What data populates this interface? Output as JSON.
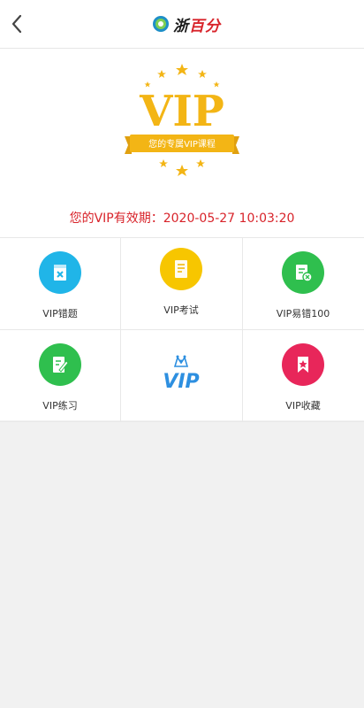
{
  "header": {
    "back_icon": "back-chevron-icon",
    "logo_text_a": "浙",
    "logo_text_b": "百分"
  },
  "badge": {
    "big_text": "VIP",
    "ribbon_text": "您的专属VIP课程"
  },
  "expiry_text": "您的VIP有效期：2020-05-27 10:03:20",
  "menu": [
    {
      "label": "VIP错题",
      "icon": "wrong-question-icon",
      "color": "#20b5e8"
    },
    {
      "label": "VIP考试",
      "icon": "exam-paper-icon",
      "color": "#f7c600"
    },
    {
      "label": "VIP易错100",
      "icon": "error-prone-icon",
      "color": "#2fbf4e"
    },
    {
      "label": "VIP练习",
      "icon": "practice-edit-icon",
      "color": "#2fbf4e"
    },
    {
      "label": "VIP",
      "icon": "vip-crown-logo",
      "color": "#2d8fe0"
    },
    {
      "label": "VIP收藏",
      "icon": "favorite-star-icon",
      "color": "#e8265a"
    }
  ],
  "colors": {
    "accent_red": "#d8232a",
    "gold": "#f3b515"
  }
}
